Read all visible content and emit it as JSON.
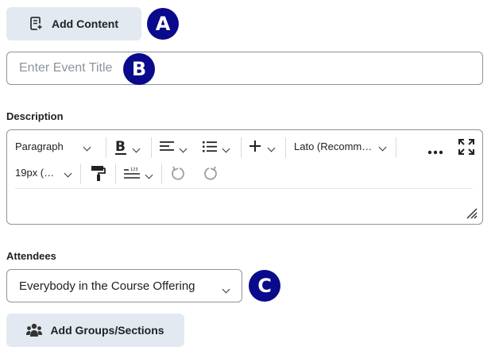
{
  "add_content": {
    "label": "Add Content",
    "icon": "add-content-icon"
  },
  "event_title": {
    "placeholder": "Enter Event Title"
  },
  "description": {
    "label": "Description",
    "toolbar": {
      "format": "Paragraph",
      "font": "Lato (Recomm…",
      "size": "19px (…",
      "icons": [
        "bold-icon",
        "align-icon",
        "list-icon",
        "insert-plus-icon",
        "more-actions-icon",
        "fullscreen-icon",
        "format-painter-icon",
        "line-spacing-icon",
        "undo-icon",
        "redo-icon",
        "resize-grip-icon"
      ]
    }
  },
  "attendees": {
    "label": "Attendees",
    "selected": "Everybody in the Course Offering"
  },
  "add_groups": {
    "label": "Add Groups/Sections",
    "icon": "groups-icon"
  },
  "callouts": {
    "a": "A",
    "b": "B",
    "c": "C"
  },
  "colors": {
    "button_bg": "#e3e9f1",
    "callout_bg": "#0a0a8c",
    "border": "#8d949b"
  }
}
